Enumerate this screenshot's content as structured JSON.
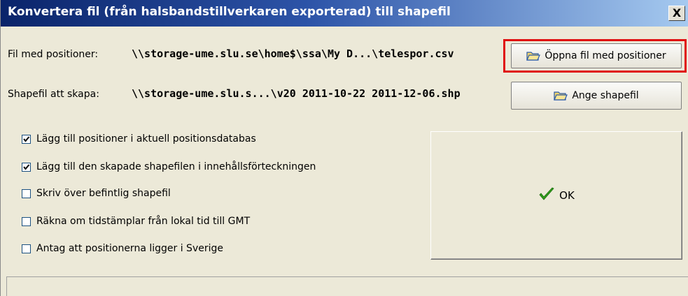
{
  "window": {
    "title": "Konvertera fil (från halsbandstillverkaren exporterad) till shapefil",
    "close_label": "X"
  },
  "position_file": {
    "label": "Fil med positioner:",
    "path": "\\\\storage-ume.slu.se\\home$\\ssa\\My D...\\telespor.csv",
    "button_label": "Öppna fil med positioner",
    "button_icon": "folder-open-icon"
  },
  "shapefile": {
    "label": "Shapefil att skapa:",
    "path": "\\\\storage-ume.slu.s...\\v20 2011-10-22 2011-12-06.shp",
    "button_label": "Ange shapefil",
    "button_icon": "folder-open-icon"
  },
  "options": [
    {
      "label": "Lägg till positioner i aktuell positionsdatabas",
      "checked": true
    },
    {
      "label": "Lägg till den skapade shapefilen i innehållsförteckningen",
      "checked": true
    },
    {
      "label": "Skriv över befintlig shapefil",
      "checked": false
    },
    {
      "label": "Räkna om tidstämplar från lokal tid till GMT",
      "checked": false
    },
    {
      "label": "Antag att positionerna ligger i Sverige",
      "checked": false
    }
  ],
  "ok_button": {
    "label": "OK",
    "icon": "checkmark-icon"
  },
  "colors": {
    "highlight": "#e01010",
    "checkmark": "#2f9e1a"
  }
}
